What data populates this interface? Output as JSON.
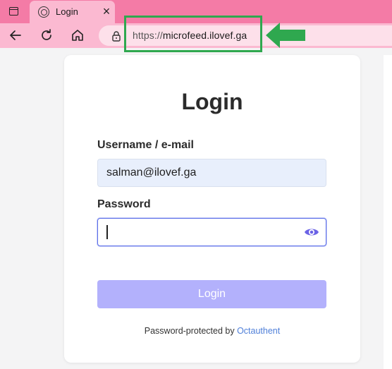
{
  "browser": {
    "tab_title": "Login",
    "tab_close": "×",
    "url_scheme": "https://",
    "url_host": "microfeed.ilovef.ga"
  },
  "icons": {
    "window": "window-icon",
    "favicon": "site-favicon-icon",
    "back": "back-arrow-icon",
    "reload": "reload-icon",
    "home": "home-icon",
    "lock": "lock-icon",
    "eye": "eye-icon",
    "annotation_arrow": "green-arrow-icon"
  },
  "colors": {
    "chrome": "#f47ba6",
    "chrome_light": "#fbb9d1",
    "highlight": "#2fa84f",
    "button": "#b3b1fc",
    "focus": "#5b6ee8",
    "link": "#4f7fd9"
  },
  "login": {
    "title": "Login",
    "username_label": "Username / e-mail",
    "username_value": "salman@ilovef.ga",
    "password_label": "Password",
    "password_value": "",
    "button_label": "Login",
    "footer_text": "Password-protected by ",
    "footer_link": "Octauthent"
  }
}
